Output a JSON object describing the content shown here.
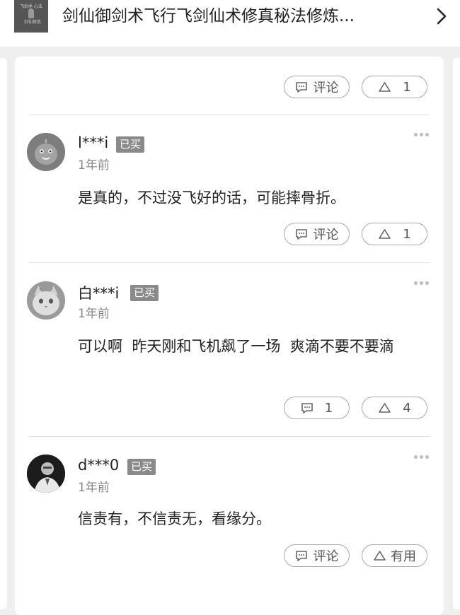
{
  "header": {
    "title": "剑仙御剑术飞行飞剑仙术修真秘法修炼...",
    "thumbnail_text": [
      "飞剑术 心法",
      "剑仙修真"
    ]
  },
  "top_actions": {
    "comment_label": "评论",
    "like_count": "1"
  },
  "comments": [
    {
      "username": "l***i",
      "badge": "已买",
      "time": "1年前",
      "text": "是真的，不过没飞好的话，可能摔骨折。",
      "comment_label": "评论",
      "like_label": "1"
    },
    {
      "username": "白***i",
      "badge": "已买",
      "time": "1年前",
      "text": "可以啊  昨天刚和飞机飙了一场  爽滴不要不要滴",
      "comment_label": "1",
      "like_label": "4"
    },
    {
      "username": "d***0",
      "badge": "已买",
      "time": "1年前",
      "text": "信责有，不信责无，看缘分。",
      "comment_label": "评论",
      "like_label": "有用"
    }
  ],
  "icons": {
    "thumbnail": "product-thumbnail",
    "chevron": "chevron-right-icon",
    "comment": "comment-bubble-icon",
    "like": "triangle-up-icon",
    "more": "more-dots-icon"
  },
  "colors": {
    "page_bg": "#efefef",
    "card_bg": "#ffffff",
    "badge_bg": "#8a8a8a",
    "pill_border": "#a9a9a9",
    "muted_text": "#888888"
  }
}
